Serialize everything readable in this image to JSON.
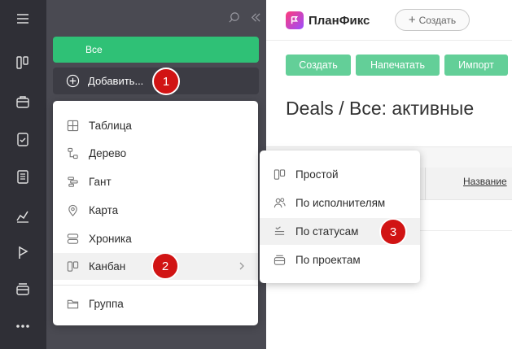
{
  "rail": {
    "items": [
      {
        "icon": "menu-icon"
      },
      {
        "icon": "columns-icon"
      },
      {
        "icon": "briefcase-icon"
      },
      {
        "icon": "clipboard-check-icon"
      },
      {
        "icon": "document-list-icon"
      },
      {
        "icon": "analytics-icon"
      },
      {
        "icon": "play-flag-icon"
      },
      {
        "icon": "storage-icon"
      },
      {
        "icon": "more-icon"
      }
    ]
  },
  "panel": {
    "all_label": "Все",
    "add_label": "Добавить..."
  },
  "header": {
    "brand": "ПланФикс",
    "create_label": "Создать"
  },
  "toolbar": {
    "buttons": [
      "Создать",
      "Напечатать",
      "Импорт"
    ]
  },
  "page": {
    "title": "Deals / Все: активные"
  },
  "table": {
    "name_column": "Название"
  },
  "add_menu": {
    "items": [
      {
        "label": "Таблица",
        "icon": "table-icon"
      },
      {
        "label": "Дерево",
        "icon": "tree-icon"
      },
      {
        "label": "Гант",
        "icon": "gantt-icon"
      },
      {
        "label": "Карта",
        "icon": "map-pin-icon"
      },
      {
        "label": "Хроника",
        "icon": "chronicle-icon"
      },
      {
        "label": "Канбан",
        "icon": "kanban-icon"
      },
      {
        "label": "Группа",
        "icon": "folder-icon"
      }
    ]
  },
  "kanban_menu": {
    "items": [
      {
        "label": "Простой",
        "icon": "columns-icon"
      },
      {
        "label": "По исполнителям",
        "icon": "people-icon"
      },
      {
        "label": "По статусам",
        "icon": "status-icon"
      },
      {
        "label": "По проектам",
        "icon": "project-icon"
      }
    ]
  },
  "badges": [
    "1",
    "2",
    "3"
  ],
  "colors": {
    "accent_green": "#2fc176",
    "button_green": "#63cf98",
    "badge_red": "#d11414",
    "rail_bg": "#2f2f36",
    "panel_bg": "#4a4a52"
  }
}
